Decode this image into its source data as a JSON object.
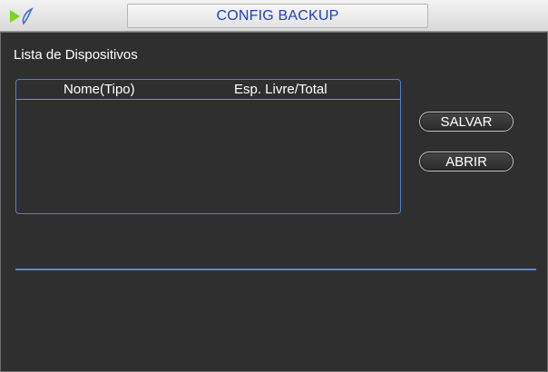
{
  "titlebar": {
    "title": "CONFIG BACKUP",
    "logo_icon": "dvr-logo-icon"
  },
  "section": {
    "label": "Lista de Dispositivos"
  },
  "device_list": {
    "columns": [
      "Nome(Tipo)",
      "Esp. Livre/Total"
    ],
    "rows": []
  },
  "buttons": {
    "save": "SALVAR",
    "open": "ABRIR"
  },
  "colors": {
    "title_text": "#1b3fbf",
    "accent_border": "#4f7fd6",
    "background": "#2f2f2f"
  }
}
